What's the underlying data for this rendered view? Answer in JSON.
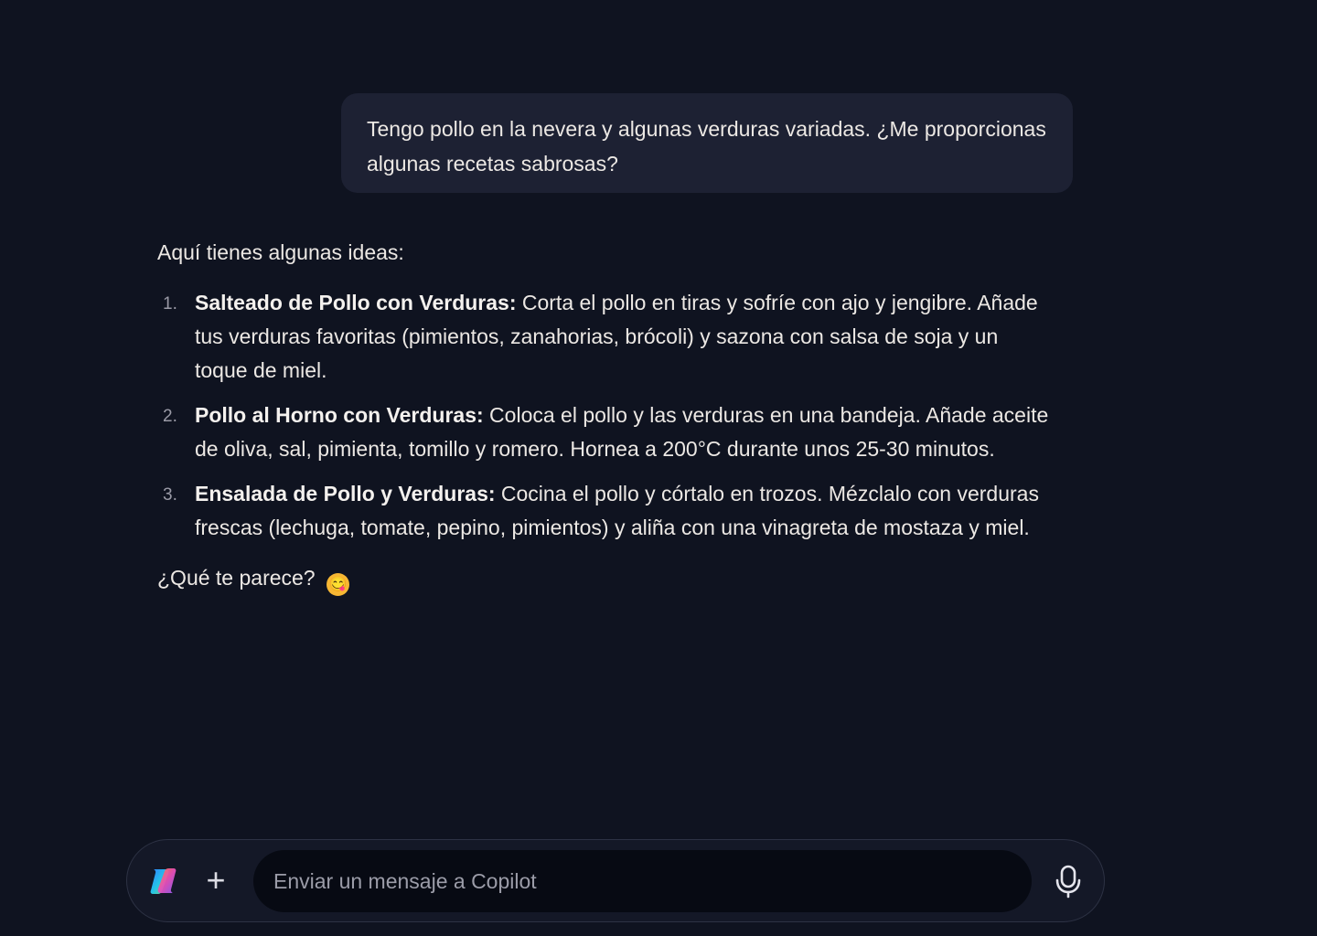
{
  "conversation": {
    "user_message": "Tengo pollo en la nevera y algunas verduras variadas. ¿Me proporcionas algunas recetas sabrosas?",
    "assistant": {
      "intro": "Aquí tienes algunas ideas:",
      "recipes": [
        {
          "number": "1.",
          "title": "Salteado de Pollo con Verduras:",
          "text": " Corta el pollo en tiras y sofríe con ajo y jengibre. Añade tus verduras favoritas (pimientos, zanahorias, brócoli) y sazona con salsa de soja y un toque de miel."
        },
        {
          "number": "2.",
          "title": "Pollo al Horno con Verduras:",
          "text": " Coloca el pollo y las verduras en una bandeja. Añade aceite de oliva, sal, pimienta, tomillo y romero. Hornea a 200°C durante unos 25-30 minutos."
        },
        {
          "number": "3.",
          "title": "Ensalada de Pollo y Verduras:",
          "text": " Cocina el pollo y córtalo en trozos. Mézclalo con verduras frescas (lechuga, tomate, pepino, pimientos) y aliña con una vinagreta de mostaza y miel."
        }
      ],
      "outro": "¿Qué te parece?",
      "emoji": "😋"
    }
  },
  "composer": {
    "logo_icon": "copilot-logo-icon",
    "add_icon": "plus-icon",
    "add_symbol": "+",
    "placeholder": "Enviar un mensaje a Copilot",
    "mic_icon": "microphone-icon"
  },
  "colors": {
    "background": "#0f1320",
    "user_bubble": "#1d2133",
    "input_background": "#070a13",
    "text": "#ece8e4",
    "placeholder": "#9b9ca8"
  }
}
